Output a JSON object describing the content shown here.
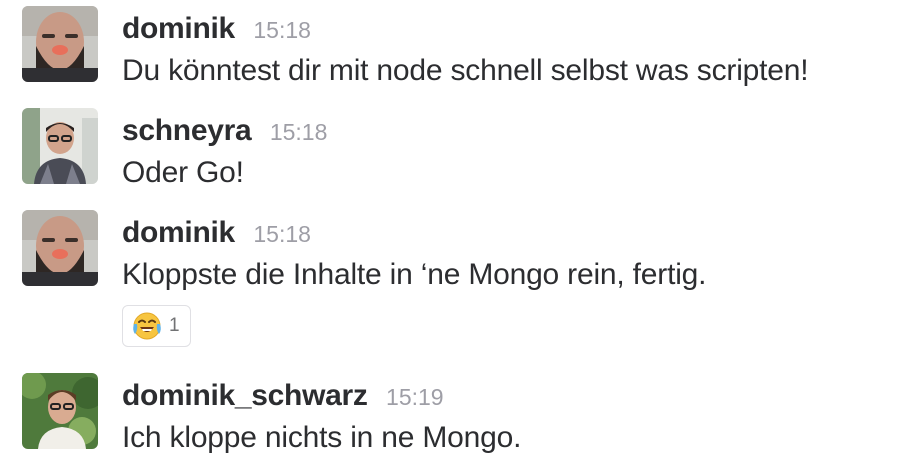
{
  "messages": [
    {
      "author": "dominik",
      "time": "15:18",
      "text": "Du könntest dir mit node schnell selbst was scripten!",
      "avatar": "avatar-dominik-bearded"
    },
    {
      "author": "schneyra",
      "time": "15:18",
      "text": "Oder Go!",
      "avatar": "avatar-schneyra-glasses"
    },
    {
      "author": "dominik",
      "time": "15:18",
      "text": "Kloppste die Inhalte in ‘ne Mongo rein, fertig.",
      "avatar": "avatar-dominik-bearded",
      "reaction": {
        "emoji": "tears-of-joy-emoji",
        "count": "1"
      }
    },
    {
      "author": "dominik_schwarz",
      "time": "15:19",
      "text": "Ich kloppe nichts in ne Mongo.",
      "avatar": "avatar-dominik-schwarz-glasses"
    }
  ],
  "colors": {
    "author": "#2c2d30",
    "timestamp": "#9e9ea6",
    "reaction_border": "#e0e0e4"
  }
}
